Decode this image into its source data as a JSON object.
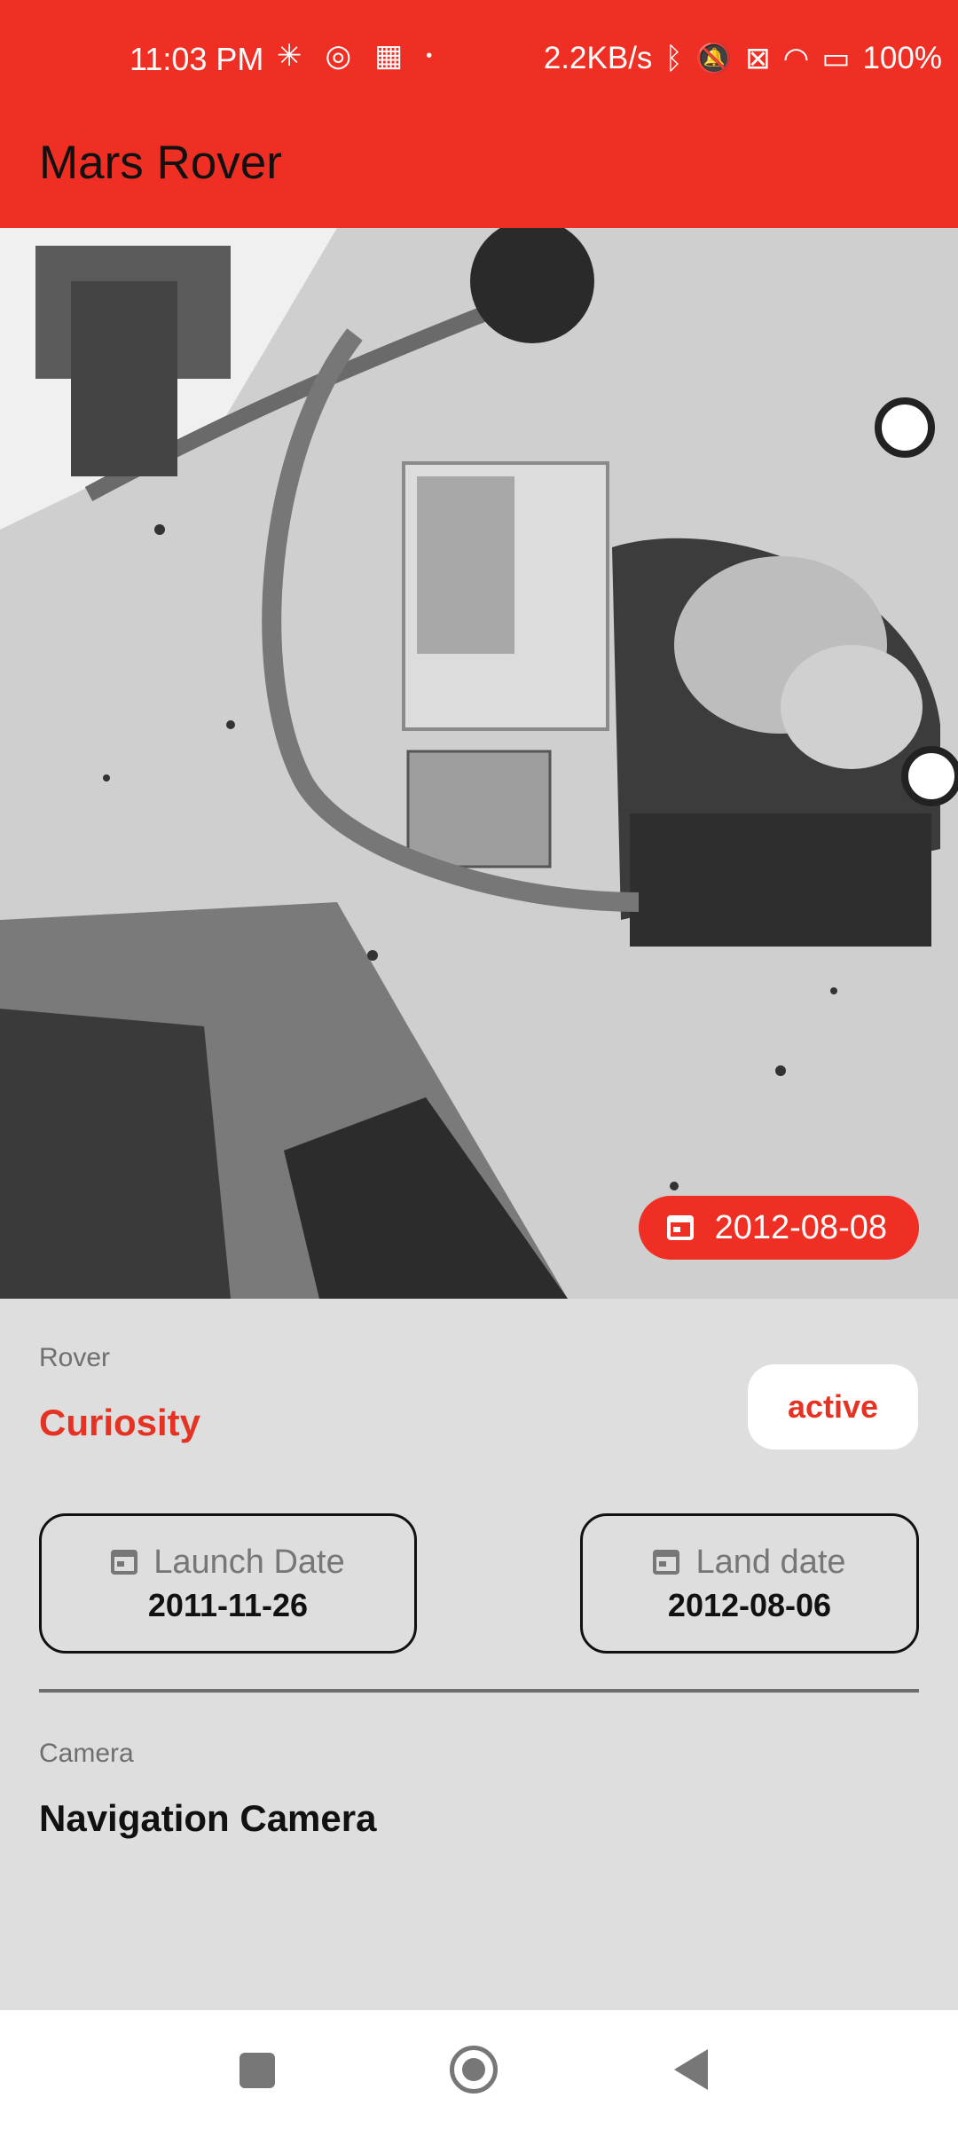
{
  "status_bar": {
    "time": "11:03 PM",
    "speed": "2.2KB/s",
    "battery": "100%"
  },
  "app_bar": {
    "title": "Mars Rover"
  },
  "photo": {
    "earth_date": "2012-08-08"
  },
  "rover": {
    "label": "Rover",
    "name": "Curiosity",
    "status": "active",
    "launch": {
      "label": "Launch Date",
      "value": "2011-11-26"
    },
    "landing": {
      "label": "Land date",
      "value": "2012-08-06"
    }
  },
  "camera": {
    "label": "Camera",
    "name": "Navigation Camera"
  },
  "colors": {
    "accent": "#ef2f24",
    "accent_text": "#e53222",
    "background": "#dedede"
  }
}
